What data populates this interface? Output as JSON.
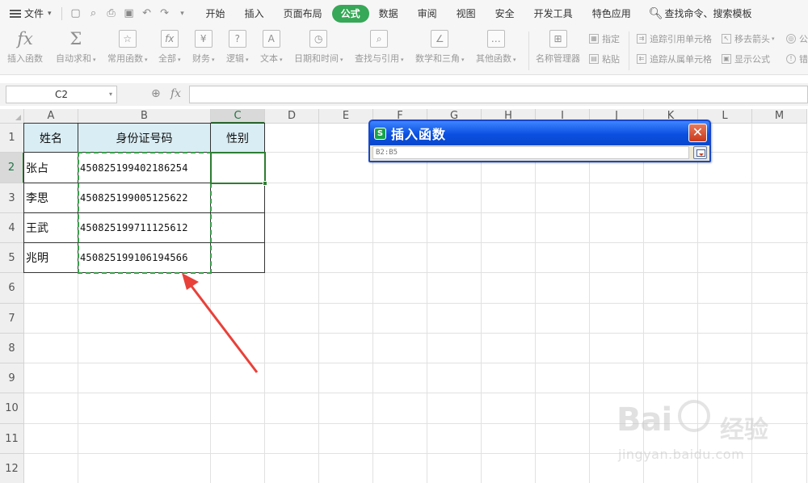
{
  "menubar": {
    "file_label": "文件",
    "tabs": [
      {
        "label": "开始"
      },
      {
        "label": "插入"
      },
      {
        "label": "页面布局"
      },
      {
        "label": "公式"
      },
      {
        "label": "数据"
      },
      {
        "label": "审阅"
      },
      {
        "label": "视图"
      },
      {
        "label": "安全"
      },
      {
        "label": "开发工具"
      },
      {
        "label": "特色应用"
      }
    ],
    "search_label": "查找命令、搜索模板",
    "active_tab_color": "#36a857"
  },
  "ribbon": {
    "buttons": [
      {
        "label": "插入函数",
        "icon": "fx-icon"
      },
      {
        "label": "自动求和",
        "icon": "sigma-icon"
      },
      {
        "label": "常用函数",
        "icon": "common-functions-icon"
      },
      {
        "label": "全部",
        "icon": "all-functions-icon"
      },
      {
        "label": "财务",
        "icon": "finance-icon"
      },
      {
        "label": "逻辑",
        "icon": "logic-icon"
      },
      {
        "label": "文本",
        "icon": "text-icon"
      },
      {
        "label": "日期和时间",
        "icon": "datetime-icon"
      },
      {
        "label": "查找与引用",
        "icon": "lookup-icon"
      },
      {
        "label": "数学和三角",
        "icon": "math-icon"
      },
      {
        "label": "其他函数",
        "icon": "other-functions-icon"
      },
      {
        "label": "名称管理器",
        "icon": "name-manager-icon"
      }
    ],
    "small_buttons": [
      {
        "label": "指定"
      },
      {
        "label": "粘贴"
      },
      {
        "label": "追踪引用单元格"
      },
      {
        "label": "追踪从属单元格"
      },
      {
        "label": "移去箭头"
      },
      {
        "label": "显示公式"
      },
      {
        "label": "公"
      },
      {
        "label": "错"
      }
    ]
  },
  "formula_bar": {
    "name_box": "C2",
    "fx_label": "fx",
    "formula": ""
  },
  "sheet": {
    "columns": [
      "A",
      "B",
      "C",
      "D",
      "E",
      "F",
      "G",
      "H",
      "I",
      "J",
      "K",
      "L",
      "M"
    ],
    "rows": [
      "1",
      "2",
      "3",
      "4",
      "5",
      "6",
      "7",
      "8",
      "9",
      "10",
      "11",
      "12"
    ],
    "selected_column": "C",
    "selected_row": "2",
    "header_fill": "#d9edf4",
    "table": {
      "headers": [
        "姓名",
        "身份证号码",
        "性别"
      ],
      "rows": [
        [
          "张占",
          "450825199402186254",
          ""
        ],
        [
          "李思",
          "450825199005125622",
          ""
        ],
        [
          "王武",
          "450825199711125612",
          ""
        ],
        [
          "兆明",
          "450825199106194566",
          ""
        ]
      ]
    }
  },
  "dialog": {
    "title": "插入函数",
    "range_value": "B2:B5",
    "title_color": "#0b4fe0"
  },
  "annotation": {
    "arrow_color": "#e8413a"
  },
  "watermark": {
    "brand": "Bai",
    "brand_cn": "经验",
    "url": "jingyan.baidu.com"
  }
}
